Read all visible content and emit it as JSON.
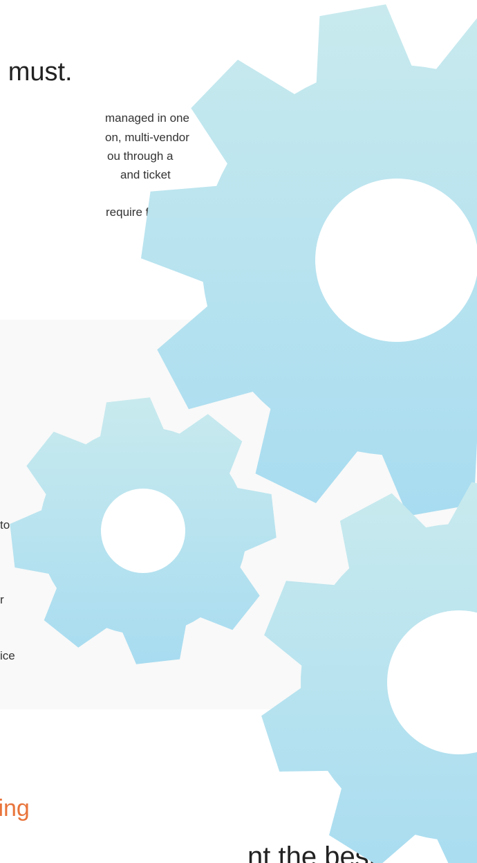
{
  "headline": {
    "text": "u must."
  },
  "intro": {
    "lines": [
      "managed in one",
      "on, multi-vendor",
      "ou through a",
      "and ticket",
      "require for"
    ]
  },
  "side_fragments": {
    "lines": [
      "to",
      "r",
      "ice"
    ]
  },
  "section": {
    "heading": "ting",
    "subheading_cut": "nt the best"
  },
  "colors": {
    "accent": "#e8743b",
    "gear_top": "#c8eaee",
    "gear_bottom": "#a8dcf0",
    "band": "#f9f9f9"
  },
  "icons": {
    "large_gear": "gear-icon",
    "small_gear": "gear-icon",
    "bottom_gear": "gear-icon"
  }
}
